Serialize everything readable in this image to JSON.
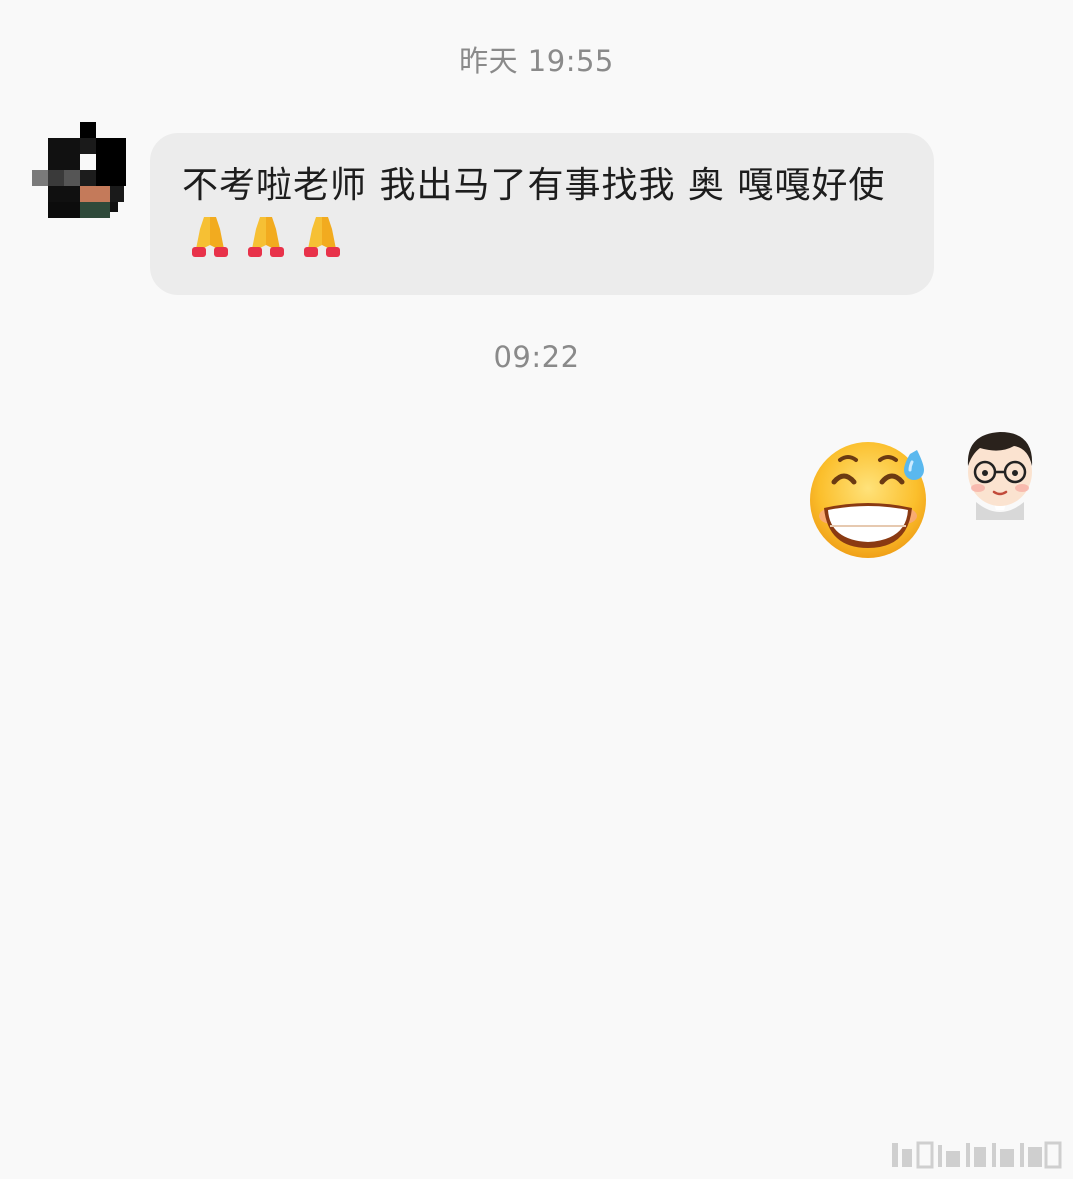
{
  "messages": {
    "timestamp_1": "昨天 19:55",
    "received": {
      "text": "不考啦老师 我出马了有事找我 奥 嘎嘎好使",
      "emojis": [
        "folded-hands",
        "folded-hands",
        "folded-hands"
      ]
    },
    "timestamp_2": "09:22",
    "sent": {
      "sticker": "grinning-sweat-face"
    }
  },
  "avatars": {
    "left": "pixelated-avatar",
    "right": "cartoon-man-glasses-avatar"
  },
  "colors": {
    "background": "#f9f9f9",
    "bubble_received": "#ececec",
    "timestamp_text": "#8a8a8a",
    "message_text": "#1d1d1d"
  }
}
